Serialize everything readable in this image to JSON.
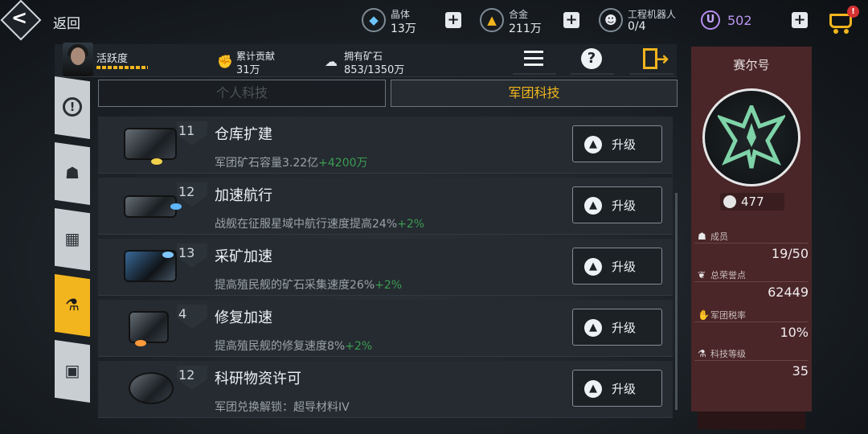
{
  "topbar": {
    "back_label": "返回",
    "resources": [
      {
        "label": "晶体",
        "value": "13万",
        "icon": "crystal-icon"
      },
      {
        "label": "合金",
        "value": "211万",
        "icon": "alloy-icon"
      },
      {
        "label": "工程机器人",
        "value": "0/4",
        "icon": "robot-icon"
      }
    ],
    "premium_currency": {
      "symbol": "U",
      "value": "502"
    },
    "cart_badge": "!"
  },
  "info": {
    "activity_label": "活跃度",
    "contribution": {
      "label": "累计贡献",
      "value": "31万"
    },
    "ore": {
      "label": "拥有矿石",
      "value": "853/1350万"
    }
  },
  "tabs": {
    "personal": "个人科技",
    "legion": "军团科技",
    "active": "legion"
  },
  "tech_items": [
    {
      "level": "11",
      "name": "仓库扩建",
      "desc": "军团矿石容量3.22亿",
      "bonus": "+4200万",
      "button": "升级"
    },
    {
      "level": "12",
      "name": "加速航行",
      "desc": "战舰在征服星域中航行速度提高24%",
      "bonus": "+2%",
      "button": "升级"
    },
    {
      "level": "13",
      "name": "采矿加速",
      "desc": "提高殖民舰的矿石采集速度26%",
      "bonus": "+2%",
      "button": "升级"
    },
    {
      "level": "4",
      "name": "修复加速",
      "desc": "提高殖民舰的修复速度8%",
      "bonus": "+2%",
      "button": "升级"
    },
    {
      "level": "12",
      "name": "科研物资许可",
      "desc": "军团兑换解锁：超导材料IV",
      "bonus": "",
      "button": "升级"
    }
  ],
  "legion": {
    "name": "赛尔号",
    "score": "477",
    "members": {
      "label": "成员",
      "value": "19/50"
    },
    "honor": {
      "label": "总荣誉点",
      "value": "62449"
    },
    "tax": {
      "label": "军团税率",
      "value": "10%"
    },
    "tech_level": {
      "label": "科技等级",
      "value": "35"
    }
  },
  "colors": {
    "accent": "#f2b51e",
    "bonus_green": "#3c9c52",
    "panel": "#4a2628",
    "emblem": "#7fd3a8"
  }
}
